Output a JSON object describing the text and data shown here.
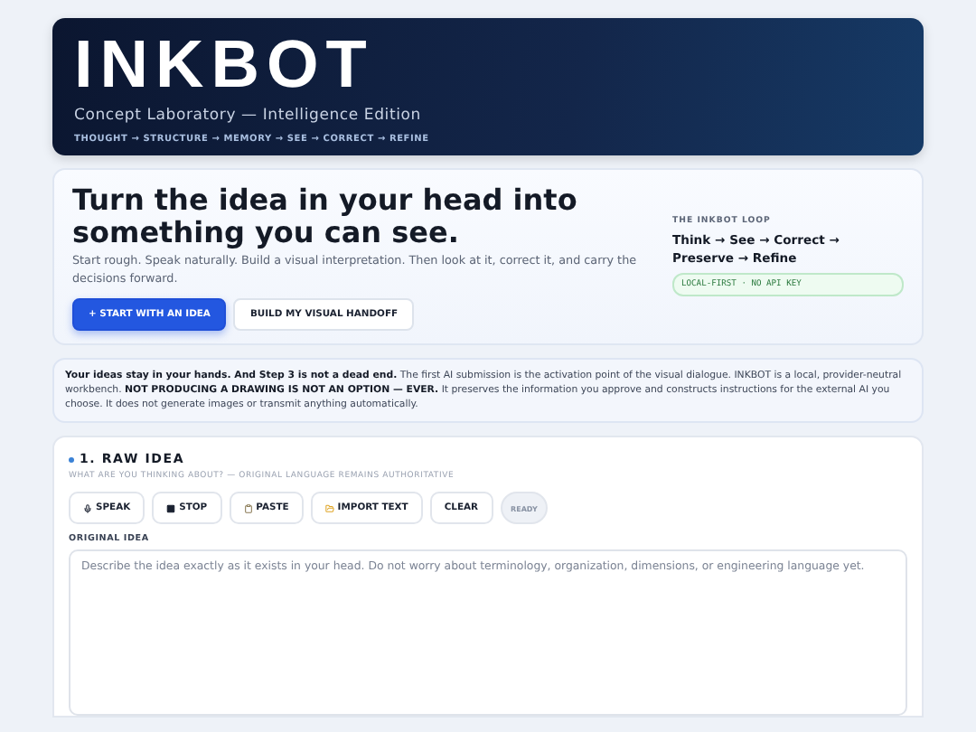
{
  "header": {
    "title": "INKBOT",
    "subtitle": "Concept Laboratory — Intelligence Edition",
    "steps": [
      "THOUGHT",
      "STRUCTURE",
      "MEMORY",
      "SEE",
      "CORRECT",
      "REFINE"
    ],
    "separator": "→"
  },
  "hero": {
    "title": "Turn the idea in your head into something you can see.",
    "lead": "Start rough. Speak naturally. Build a visual interpretation. Then look at it, correct it, and carry the decisions forward.",
    "buttons": [
      {
        "label": "+ START WITH AN IDEA",
        "kind": "primary"
      },
      {
        "label": "BUILD MY VISUAL HANDOFF",
        "kind": "secondary"
      }
    ],
    "loop": {
      "heading": "THE INKBOT LOOP",
      "text": "Think → See → Correct → Preserve → Refine",
      "badge": "LOCAL-FIRST · NO API KEY"
    }
  },
  "notice": "**Your ideas stay in your hands. And Step 3 is not a dead end.** The first AI submission is the activation point of the visual dialogue. INKBOT is a local, provider-neutral workbench. **NOT PRODUCING A DRAWING IS NOT AN OPTION — EVER.** It preserves the information you approve and constructs instructions for the external AI you choose. It does not generate images or transmit anything automatically.",
  "section": {
    "title": "1. RAW IDEA",
    "hint": "WHAT ARE YOU THINKING ABOUT? — ORIGINAL LANGUAGE REMAINS AUTHORITATIVE",
    "tools": [
      {
        "label": "SPEAK",
        "kind": "mic"
      },
      {
        "label": "STOP",
        "kind": "stop"
      },
      {
        "label": "PASTE",
        "kind": "paste"
      },
      {
        "label": "IMPORT TEXT",
        "kind": "import"
      },
      {
        "label": "CLEAR",
        "kind": "plain"
      }
    ],
    "status": "READY",
    "field_label": "ORIGINAL IDEA",
    "placeholder": "Describe the idea exactly as it exists in your head. Do not worry about terminology, organization, dimensions, or engineering language yet."
  }
}
